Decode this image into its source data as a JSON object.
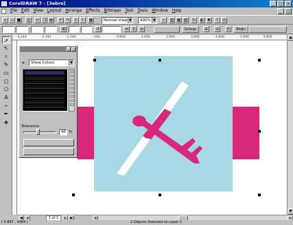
{
  "window": {
    "title": "CorelDRAW 7 - [3ebro]",
    "controls": [
      "_",
      "□",
      "x"
    ]
  },
  "menu": {
    "items": [
      "File",
      "Edit",
      "View",
      "Layout",
      "Arrange",
      "Effects",
      "Bitmaps",
      "Text",
      "Tools",
      "Window",
      "Help"
    ]
  },
  "toolbar": {
    "view_mode": "Normal View",
    "zoom": "400%"
  },
  "property_bar": {
    "group_label": "Group",
    "align_label": "Align"
  },
  "color_panel": {
    "mode": "Show Colors",
    "tolerance_label": "Tolerance",
    "tolerance_value": "40",
    "tolerance_unit": "%",
    "tolerance_fraction": 0.4,
    "button1": "",
    "button2": ""
  },
  "ruler": {
    "h_ticks": [
      "-3.144",
      "-2.144",
      "-1.144",
      "-.144",
      "0.856",
      "1.856",
      "2.856",
      "3.856",
      "4.856",
      "5.856",
      "6.856"
    ]
  },
  "page_nav": {
    "page_tab": "1 of 1"
  },
  "status": {
    "coords": "( 5.897 , 4364 )",
    "message": "2 Objects Selected on Layer 1"
  },
  "colors": {
    "light_blue": "#a8d8e4",
    "magenta": "#d8287a",
    "title_blue": "#000080"
  }
}
